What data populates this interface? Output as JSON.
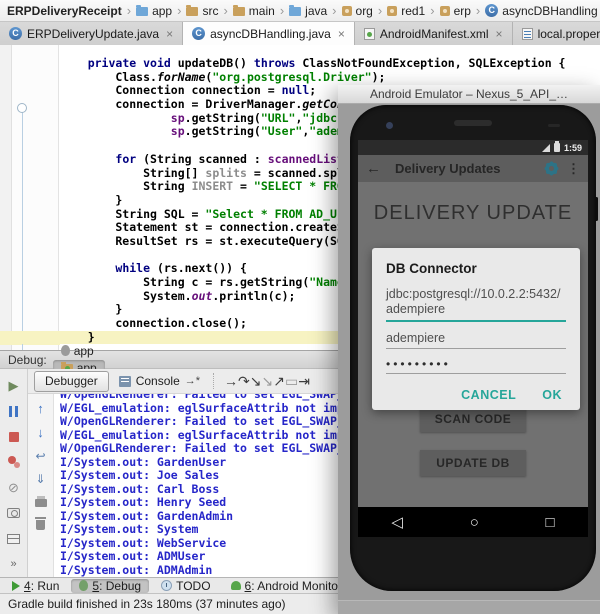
{
  "breadcrumbs": {
    "items": [
      {
        "label": "ERPDeliveryReceipt",
        "icon": null,
        "bold": true
      },
      {
        "label": "app",
        "icon": "folder-blue"
      },
      {
        "label": "src",
        "icon": "folder-tan"
      },
      {
        "label": "main",
        "icon": "folder-tan"
      },
      {
        "label": "java",
        "icon": "folder-blue"
      },
      {
        "label": "org",
        "icon": "package"
      },
      {
        "label": "red1",
        "icon": "package"
      },
      {
        "label": "erp",
        "icon": "package"
      },
      {
        "label": "asyncDBHandling",
        "icon": "class"
      }
    ]
  },
  "tabs": {
    "items": [
      {
        "label": "ERPDeliveryUpdate.java",
        "icon": "class",
        "active": false
      },
      {
        "label": "asyncDBHandling.java",
        "icon": "class",
        "active": true
      },
      {
        "label": "AndroidManifest.xml",
        "icon": "manifest",
        "active": false
      },
      {
        "label": "local.properties",
        "icon": "properties",
        "active": false
      }
    ]
  },
  "editor": {
    "highlight_line": 20,
    "code_lines": [
      [
        [
          "p",
          "    "
        ],
        [
          "k",
          "private"
        ],
        [
          "p",
          " "
        ],
        [
          "k",
          "void"
        ],
        [
          "p",
          " updateDB() "
        ],
        [
          "k",
          "throws"
        ],
        [
          "p",
          " ClassNotFoundException, SQLException {"
        ]
      ],
      [
        [
          "p",
          "        Class."
        ],
        [
          "i",
          "forName"
        ],
        [
          "p",
          "("
        ],
        [
          "s",
          "\"org.postgresql.Driver\""
        ],
        [
          "p",
          ");"
        ]
      ],
      [
        [
          "p",
          "        Connection connection = "
        ],
        [
          "k",
          "null"
        ],
        [
          "p",
          ";"
        ]
      ],
      [
        [
          "p",
          "        connection = DriverManager."
        ],
        [
          "i",
          "getConnectio"
        ]
      ],
      [
        [
          "p",
          "                "
        ],
        [
          "f",
          "sp"
        ],
        [
          "p",
          ".getString("
        ],
        [
          "s",
          "\"URL\""
        ],
        [
          "p",
          ","
        ],
        [
          "s",
          "\"jdbc:postg"
        ]
      ],
      [
        [
          "p",
          "                "
        ],
        [
          "f",
          "sp"
        ],
        [
          "p",
          ".getString("
        ],
        [
          "s",
          "\"User\""
        ],
        [
          "p",
          ","
        ],
        [
          "s",
          "\"adempiere"
        ]
      ],
      [],
      [
        [
          "p",
          "        "
        ],
        [
          "k",
          "for"
        ],
        [
          "p",
          " (String scanned : "
        ],
        [
          "f",
          "scannedList"
        ],
        [
          "p",
          ") {"
        ]
      ],
      [
        [
          "p",
          "            String[] "
        ],
        [
          "g",
          "splits"
        ],
        [
          "p",
          " = scanned.split("
        ],
        [
          "s",
          "\","
        ]
      ],
      [
        [
          "p",
          "            String "
        ],
        [
          "g",
          "INSERT"
        ],
        [
          "p",
          " = "
        ],
        [
          "s",
          "\"SELECT * FROM AD_"
        ]
      ],
      [
        [
          "p",
          "        }"
        ]
      ],
      [
        [
          "p",
          "        String SQL = "
        ],
        [
          "s",
          "\"Select * FROM AD_User\""
        ],
        [
          "p",
          ";"
        ]
      ],
      [
        [
          "p",
          "        Statement st = connection.createStatem"
        ]
      ],
      [
        [
          "p",
          "        ResultSet rs = st.executeQuery(SQL);"
        ]
      ],
      [],
      [
        [
          "p",
          "        "
        ],
        [
          "k",
          "while"
        ],
        [
          "p",
          " (rs.next()) {"
        ]
      ],
      [
        [
          "p",
          "            String c = rs.getString("
        ],
        [
          "s",
          "\"Name\""
        ],
        [
          "p",
          ");"
        ]
      ],
      [
        [
          "p",
          "            System."
        ],
        [
          "fi",
          "out"
        ],
        [
          "p",
          ".println(c);"
        ]
      ],
      [
        [
          "p",
          "        }"
        ]
      ],
      [
        [
          "p",
          "        connection.close();"
        ]
      ],
      [
        [
          "p",
          "    }"
        ]
      ]
    ]
  },
  "debug_panel": {
    "label": "Debug:",
    "tabs": [
      {
        "label": "app",
        "icon": "bug-tab-icon",
        "active": false
      },
      {
        "label": "app",
        "icon": "app-tab-icon",
        "active": true
      }
    ],
    "debugger_tab": "Debugger",
    "console_tab": "Console",
    "console_pin": "→*",
    "step_icons": [
      {
        "name": "show-execution-point-icon",
        "glyph": "→",
        "dim": false
      },
      {
        "name": "step-over-icon",
        "glyph": "↷",
        "dim": false
      },
      {
        "name": "step-into-icon",
        "glyph": "↘",
        "dim": false
      },
      {
        "name": "force-step-into-icon",
        "glyph": "↘",
        "dim": true
      },
      {
        "name": "step-out-icon",
        "glyph": "↗",
        "dim": false
      },
      {
        "name": "drop-frame-icon",
        "glyph": "▭",
        "dim": true
      },
      {
        "name": "run-to-cursor-icon",
        "glyph": "⇥",
        "dim": false
      }
    ],
    "left_toolbar": [
      "rerun-icon",
      "pause-icon",
      "stop-icon",
      "view-breakpoints-icon",
      "mute-breakpoints-icon",
      "screenshot-icon",
      "restore-layout-icon",
      "more-icon"
    ],
    "console_gutter": [
      "up-stack-icon",
      "down-stack-icon",
      "soft-wrap-icon",
      "scroll-end-icon",
      "print-icon",
      "clear-all-icon"
    ],
    "console_lines": [
      "W/OpenGLRenderer: Failed to set EGL_SWAP_B",
      "W/EGL_emulation: eglSurfaceAttrib not impl",
      "W/OpenGLRenderer: Failed to set EGL_SWAP_B",
      "W/EGL_emulation: eglSurfaceAttrib not impl",
      "W/OpenGLRenderer: Failed to set EGL_SWAP_B",
      "I/System.out: GardenUser",
      "I/System.out: Joe Sales",
      "I/System.out: Carl Boss",
      "I/System.out: Henry Seed",
      "I/System.out: GardenAdmin",
      "I/System.out: System",
      "I/System.out: WebService",
      "I/System.out: ADMUser",
      "I/System.out: ADMAdmin"
    ]
  },
  "bottom_bar": {
    "items": [
      {
        "num": "4",
        "label": "Run",
        "icon": "run-icon",
        "active": false
      },
      {
        "num": "5",
        "label": "Debug",
        "icon": "debug-bug-icon",
        "active": true
      },
      {
        "num": null,
        "label": "TODO",
        "icon": "todo-icon",
        "active": false
      },
      {
        "num": "6",
        "label": "Android Monitor",
        "icon": "android-icon",
        "active": false
      }
    ]
  },
  "status_bar": {
    "text": "Gradle build finished in 23s 180ms (37 minutes ago)"
  },
  "emulator": {
    "window_title": "Android Emulator – Nexus_5_API_…",
    "status_time": "1:59",
    "appbar_title": "Delivery Updates",
    "screen_title": "DELIVERY UPDATE",
    "dialog": {
      "title": "DB Connector",
      "url_line1": "jdbc:postgresql://10.0.2.2:5432/",
      "url_line2": "adempiere",
      "username": "adempiere",
      "password_masked": "•••••••••",
      "cancel_label": "CANCEL",
      "ok_label": "OK"
    },
    "scan_button": "SCAN CODE",
    "update_button": "UPDATE DB"
  },
  "colors": {
    "accent_teal": "#26a69a",
    "keyword": "#000080",
    "string": "#008000",
    "field_purple": "#660e7a",
    "console_text": "#2626c9",
    "highlight_line_bg": "#f7f3c2"
  },
  "icon_glyphs": {
    "chevron-right": "›",
    "close": "×",
    "rerun-icon": "▶",
    "mute-breakpoints-icon": "⊘",
    "more-icon": "»",
    "up-stack-icon": "↑",
    "down-stack-icon": "↓",
    "soft-wrap-icon": "↩",
    "scroll-end-icon": "⇓",
    "back-icon": "←",
    "overflow-icon": "⋮",
    "nav-back": "◁",
    "nav-home": "○",
    "nav-recents": "□"
  }
}
